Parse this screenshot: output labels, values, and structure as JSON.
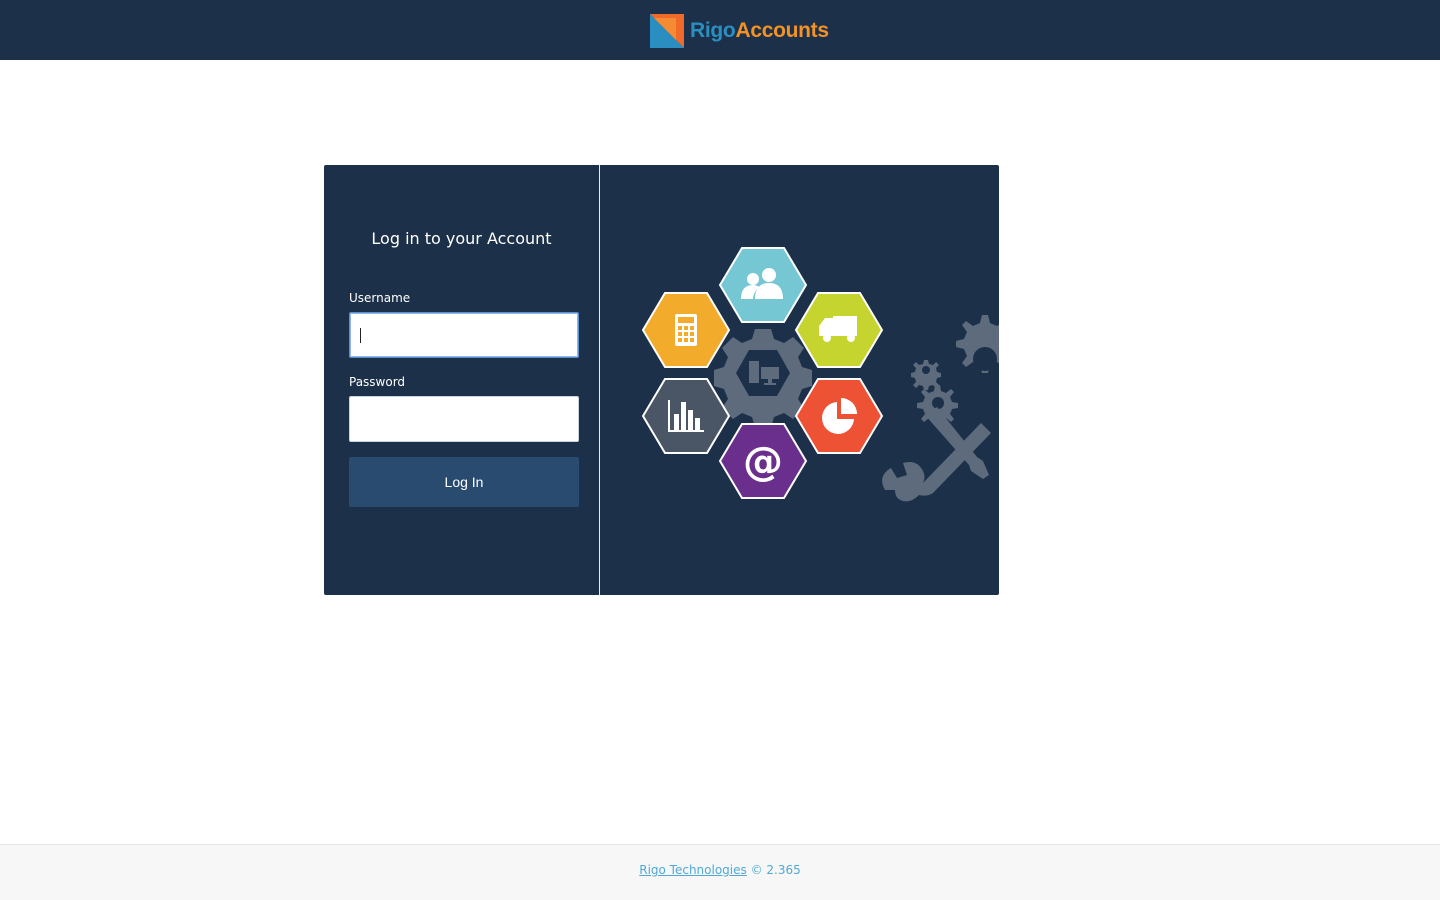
{
  "header": {
    "logo": {
      "part1": "Rigo",
      "part2": "Accounts"
    }
  },
  "login": {
    "title": "Log in to your Account",
    "username_label": "Username",
    "username_value": "",
    "password_label": "Password",
    "password_value": "",
    "submit_label": "Log In"
  },
  "illustration": {
    "icons": [
      "users-icon",
      "calculator-icon",
      "truck-icon",
      "computer-gear-icon",
      "bar-chart-icon",
      "pie-chart-icon",
      "email-at-icon",
      "gears-icon",
      "wrench-screwdriver-icon"
    ]
  },
  "footer": {
    "company_link": "Rigo Technologies",
    "version": "© 2.365"
  },
  "colors": {
    "topbar": "#1d3049",
    "card": "#1c3049",
    "button": "#294b6f",
    "link": "#4fa9d8",
    "hex_teal": "#74c7d3",
    "hex_orange": "#f2ab2a",
    "hex_lime": "#c5d42f",
    "hex_slate": "#4a5566",
    "hex_red": "#ee5235",
    "hex_purple": "#6a2f8c"
  }
}
